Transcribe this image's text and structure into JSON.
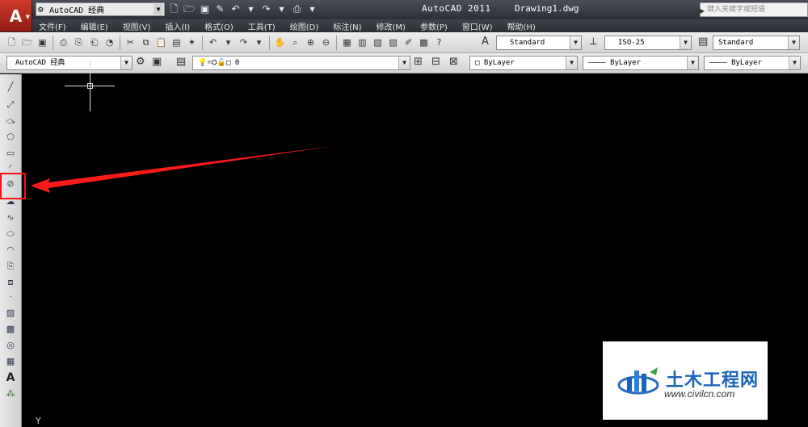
{
  "window": {
    "app_name": "AutoCAD 2011",
    "file_name": "Drawing1.dwg",
    "app_logo": "A",
    "workspace": "AutoCAD 经典",
    "search_placeholder": "键入关键字或短语"
  },
  "menu": {
    "items": [
      "文件(F)",
      "编辑(E)",
      "视图(V)",
      "插入(I)",
      "格式(O)",
      "工具(T)",
      "绘图(D)",
      "标注(N)",
      "修改(M)",
      "参数(P)",
      "窗口(W)",
      "帮助(H)"
    ]
  },
  "styles_toolbar": {
    "text_style": "Standard",
    "dim_style": "ISO-25",
    "table_style": "Standard"
  },
  "layers_toolbar": {
    "workspace": "AutoCAD 经典",
    "current_layer": "0",
    "color": "ByLayer",
    "linetype": "ByLayer",
    "lineweight": "ByLayer"
  },
  "canvas": {
    "ucs_label": "Y",
    "background": "#000000",
    "highlight_color": "#ff1010"
  },
  "left_toolbar": {
    "icons": [
      "line-icon",
      "construction-line-icon",
      "polyline-icon",
      "polygon-icon",
      "rectangle-icon",
      "arc-icon",
      "circle-icon",
      "revision-cloud-icon",
      "spline-icon",
      "ellipse-icon",
      "ellipse-arc-icon",
      "insert-block-icon",
      "make-block-icon",
      "point-icon",
      "hatch-icon",
      "gradient-icon",
      "region-icon",
      "table-icon",
      "multiline-text-icon",
      "add-selected-icon"
    ],
    "text_tool_label": "A"
  },
  "watermark": {
    "cn_text": "土木工程网",
    "url": "www.civilcn.com"
  }
}
